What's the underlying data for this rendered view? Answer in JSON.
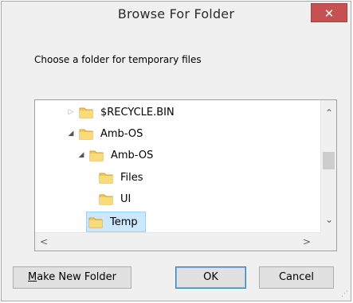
{
  "dialog": {
    "title": "Browse For Folder",
    "close_glyph": "✕",
    "prompt": "Choose a folder for temporary files"
  },
  "tree": {
    "items": [
      {
        "label": "$RECYCLE.BIN",
        "expander": "▷",
        "state": "collapsed",
        "icon": "folder-icon"
      },
      {
        "label": "Amb-OS",
        "expander": "◢",
        "state": "expanded",
        "icon": "folder-icon"
      },
      {
        "label": "Amb-OS",
        "expander": "◢",
        "state": "expanded",
        "icon": "folder-icon"
      },
      {
        "label": "Files",
        "expander": "",
        "state": "leaf",
        "icon": "folder-icon"
      },
      {
        "label": "UI",
        "expander": "",
        "state": "leaf",
        "icon": "folder-icon"
      },
      {
        "label": "Temp",
        "expander": "",
        "state": "selected",
        "icon": "folder-icon"
      }
    ],
    "selected_label": "Temp",
    "selection_color": "#cce8ff",
    "scroll_up": "⌃",
    "scroll_down": "⌄",
    "scroll_left": "<",
    "scroll_right": ">"
  },
  "buttons": {
    "make_new_folder_mnemonic": "M",
    "make_new_folder_rest": "ake New Folder",
    "ok": "OK",
    "cancel": "Cancel"
  },
  "colors": {
    "close_bg": "#c75050",
    "folder_yellow": "#f3c750"
  }
}
